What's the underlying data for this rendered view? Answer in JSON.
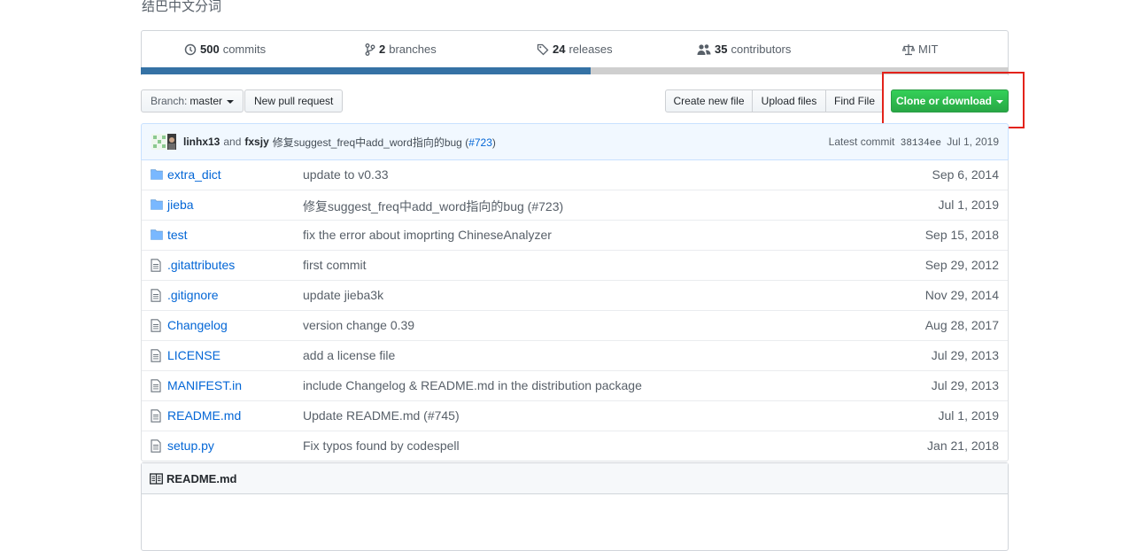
{
  "repo": {
    "description": "结巴中文分词"
  },
  "summary": {
    "commits": {
      "count": "500",
      "label": "commits"
    },
    "branches": {
      "count": "2",
      "label": "branches"
    },
    "releases": {
      "count": "24",
      "label": "releases"
    },
    "contributors": {
      "count": "35",
      "label": "contributors"
    },
    "license": "MIT"
  },
  "language_bar": {
    "fraction": 0.518,
    "colors": [
      "#3572a5",
      "#cfcfcf"
    ]
  },
  "toolbar": {
    "branch_prefix": "Branch:",
    "branch_name": "master",
    "new_pull_request": "New pull request",
    "create_new_file": "Create new file",
    "upload_files": "Upload files",
    "find_file": "Find File",
    "clone_or_download": "Clone or download"
  },
  "latest_commit": {
    "author": "linhx13",
    "and": "and",
    "coauthor": "fxsjy",
    "message": "修复suggest_freq中add_word指向的bug (",
    "pr_link": "#723",
    "message_end": ")",
    "label": "Latest commit",
    "sha": "38134ee",
    "date": "Jul 1, 2019"
  },
  "files": [
    {
      "type": "dir",
      "icon": "folder-icon",
      "name": "extra_dict",
      "message": "update to v0.33",
      "age": "Sep 6, 2014"
    },
    {
      "type": "dir",
      "icon": "folder-icon",
      "name": "jieba",
      "message": "修复suggest_freq中add_word指向的bug (#723)",
      "age": "Jul 1, 2019"
    },
    {
      "type": "dir",
      "icon": "folder-icon",
      "name": "test",
      "message": "fix the error about imoprting ChineseAnalyzer",
      "age": "Sep 15, 2018"
    },
    {
      "type": "file",
      "icon": "file-icon",
      "name": ".gitattributes",
      "message": "first commit",
      "age": "Sep 29, 2012"
    },
    {
      "type": "file",
      "icon": "file-icon",
      "name": ".gitignore",
      "message": "update jieba3k",
      "age": "Nov 29, 2014"
    },
    {
      "type": "file",
      "icon": "file-icon",
      "name": "Changelog",
      "message": "version change 0.39",
      "age": "Aug 28, 2017"
    },
    {
      "type": "file",
      "icon": "file-icon",
      "name": "LICENSE",
      "message": "add a license file",
      "age": "Jul 29, 2013"
    },
    {
      "type": "file",
      "icon": "file-icon",
      "name": "MANIFEST.in",
      "message": "include Changelog & README.md in the distribution package",
      "age": "Jul 29, 2013"
    },
    {
      "type": "file",
      "icon": "file-icon",
      "name": "README.md",
      "message": "Update README.md (#745)",
      "age": "Jul 1, 2019"
    },
    {
      "type": "file",
      "icon": "file-icon",
      "name": "setup.py",
      "message": "Fix typos found by codespell",
      "age": "Jan 21, 2018"
    }
  ],
  "readme": {
    "title": "README.md"
  }
}
